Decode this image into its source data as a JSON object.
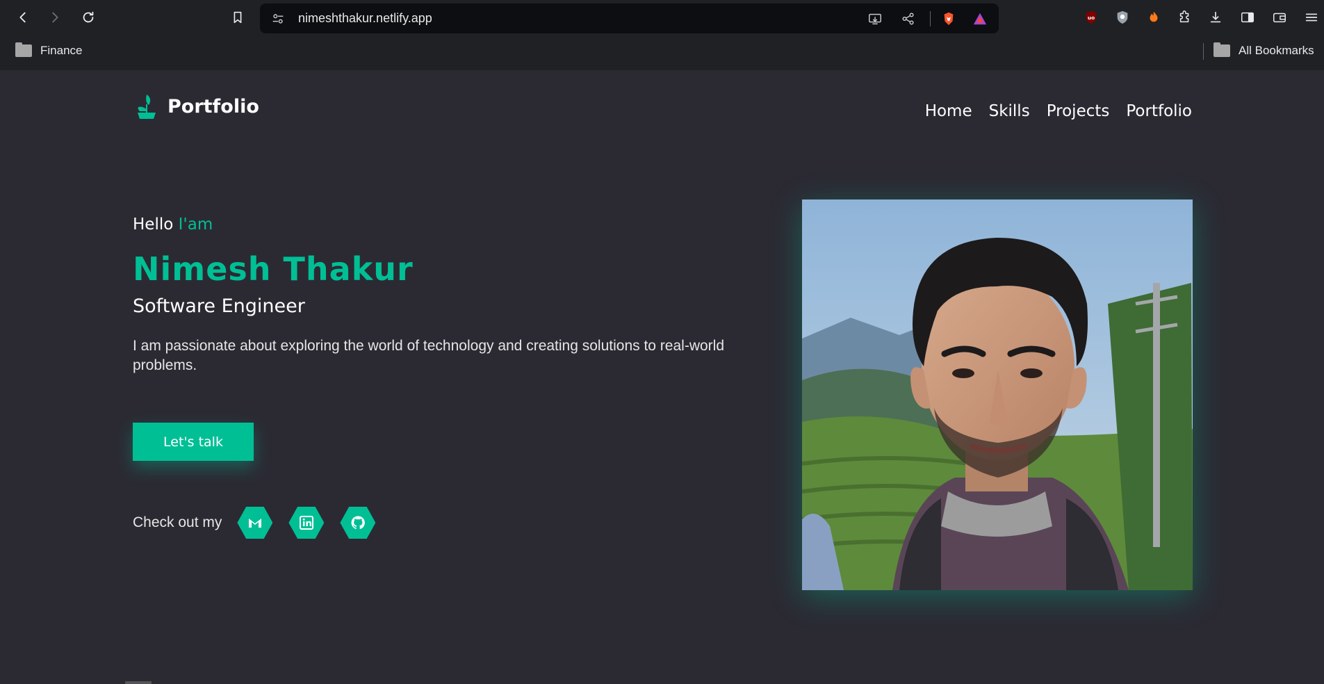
{
  "browser": {
    "url": "nimeshthakur.netlify.app",
    "bookmarks": [
      {
        "label": "Finance"
      },
      {
        "label": "All Bookmarks"
      }
    ]
  },
  "site": {
    "logo_text": "Portfolio",
    "nav": [
      "Home",
      "Skills",
      "Projects",
      "Portfolio"
    ],
    "hero": {
      "hello": "Hello",
      "hello_accent": "I'am",
      "name": "Nimesh Thakur",
      "role": "Software Engineer",
      "description": "I am passionate about exploring the world of technology and creating solutions to real-world problems.",
      "cta_label": "Let's talk",
      "social_label": "Check out my",
      "social_icons": [
        "gmail-icon",
        "linkedin-icon",
        "github-icon"
      ]
    }
  },
  "colors": {
    "accent": "#00bf95",
    "background": "#2b2a33",
    "chrome": "#202124",
    "urlbar": "#0d0e11"
  }
}
